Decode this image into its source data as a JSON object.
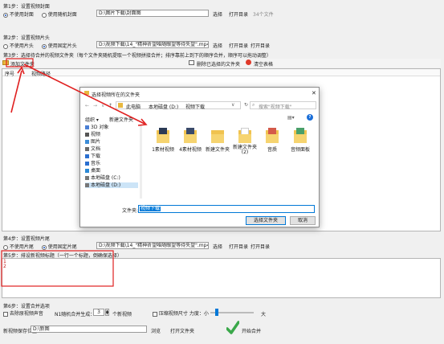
{
  "step1": {
    "title": "第1步：设置视频封面",
    "opt_none": "不使用封面",
    "opt_random": "使用随机封面",
    "path": "D:\\图片下载\\封面图",
    "select": "选择",
    "open_dir": "打开目录",
    "count": "34个文件"
  },
  "step2": {
    "title": "第2步：设置视频片头",
    "opt_none": "不使用片头",
    "opt_fixed": "使用固定片头",
    "path": "D:\\视频下载\\14_\"精神祈望唯随眼望等待失望\".mp4",
    "select": "选择",
    "open_dir": "打开目录"
  },
  "step3": {
    "title": "第3步：选择待合并的视频文件夹（每个文件夹随机提取一个视频拼接合并；排序靠前上到下的顺序合并，顺序可以拖动调整）",
    "add_folder": "添加文件夹",
    "remove_selected": "删除已选择的文件夹",
    "clear_table": "清空表格",
    "columns": [
      "序号",
      "视频路径"
    ]
  },
  "dialog": {
    "title": "选择视频所在的文件夹",
    "close": "✕",
    "breadcrumb": [
      "此电脑",
      "本地磁盘 (D:)",
      "视频下载"
    ],
    "search_placeholder": "搜索\"视频下载\"",
    "organize": "组织 ▾",
    "new_folder": "新建文件夹",
    "tree": [
      {
        "label": "3D 对象",
        "icon": "3d-objects-icon",
        "color": "#4a7fd4"
      },
      {
        "label": "视频",
        "icon": "video-icon",
        "color": "#555555"
      },
      {
        "label": "图片",
        "icon": "pictures-icon",
        "color": "#3c8dd8"
      },
      {
        "label": "文档",
        "icon": "documents-icon",
        "color": "#6a6a6a"
      },
      {
        "label": "下载",
        "icon": "download-icon",
        "color": "#2a6fd0"
      },
      {
        "label": "音乐",
        "icon": "music-icon",
        "color": "#2a6fd0"
      },
      {
        "label": "桌面",
        "icon": "desktop-icon",
        "color": "#2a89d6"
      },
      {
        "label": "本地磁盘 (C:)",
        "icon": "drive-icon",
        "color": "#777777"
      },
      {
        "label": "本地磁盘 (D:)",
        "icon": "drive-icon",
        "color": "#777777"
      }
    ],
    "folders": [
      {
        "name": "1素材视频"
      },
      {
        "name": "4素材视频"
      },
      {
        "name": "新建文件夹"
      },
      {
        "name": "新建文件夹 (2)"
      },
      {
        "name": "音质"
      },
      {
        "name": "音频面板"
      }
    ],
    "folder_label": "文件夹:",
    "folder_value": "视频下载",
    "select_folder": "选择文件夹",
    "cancel": "取消"
  },
  "step4": {
    "title": "第4步：设置视频片尾",
    "opt_none": "不使用片尾",
    "opt_fixed": "使用固定片尾",
    "path": "D:\\视频下载\\14_\"精神祈望唯随眼望等待失望\".mp4",
    "select": "选择",
    "open_dir": "打开目录"
  },
  "step5": {
    "title": "第5步：排设新视频标题（一行一个标题，倒确保选择）",
    "line_numbers": [
      "1",
      "2"
    ]
  },
  "step6": {
    "title": "第6步：设置合并选项",
    "remove_audio": "去除原视频声音",
    "per_video_label": "N1随机合并生成：",
    "per_video_value": "3",
    "per_video_unit": "个新视频",
    "compress": "压缩视频尺寸 力度：小",
    "compress_max": "大",
    "save_label": "新视频保存位置：",
    "save_path": "D:\\新图",
    "browse": "浏览",
    "open_folder": "打开文件夹",
    "start": "开始合并"
  },
  "colors": {
    "annotation_red": "#e02020",
    "start_green": "#3aa84a",
    "accent_blue": "#0078d7"
  }
}
